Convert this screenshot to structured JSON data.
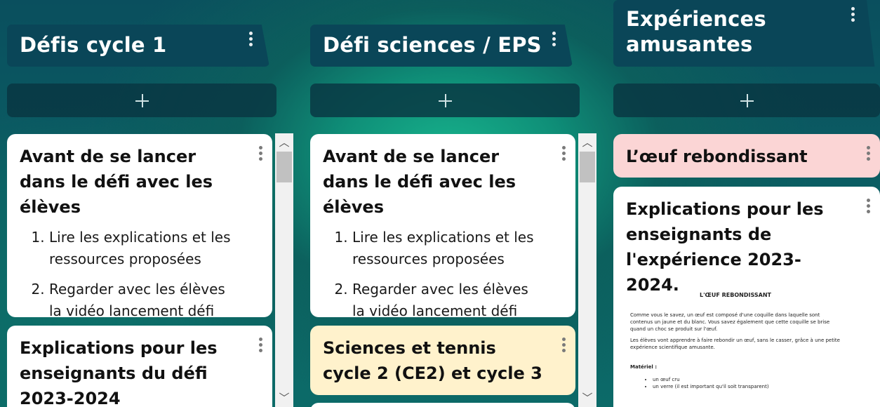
{
  "columns": [
    {
      "title": "Défis cycle 1",
      "cards": [
        {
          "title": "Avant de se lancer dans le défi avec les élèves",
          "items": [
            "Lire les explications et les ressources proposées",
            "Regarder avec les élèves la vidéo lancement défi"
          ]
        },
        {
          "title": "Explications pour les enseignants du défi 2023-2024"
        }
      ]
    },
    {
      "title": "Défi sciences / EPS",
      "cards": [
        {
          "title": "Avant de se lancer dans le défi avec les élèves",
          "items": [
            "Lire les explications et les ressources proposées",
            "Regarder avec les élèves la vidéo lancement défi"
          ]
        },
        {
          "title": "Sciences et tennis cycle 2 (CE2) et cycle 3"
        }
      ]
    },
    {
      "title": "Expériences amusantes",
      "cards": [
        {
          "title": "L’œuf rebondissant"
        },
        {
          "title": "Explications pour les enseignants de l'expérience 2023-2024.",
          "document": {
            "heading": "L'ŒUF REBONDISSANT",
            "paragraphs": [
              "Comme vous le savez, un œuf est composé d'une coquille dans laquelle sont contenus un jaune et du blanc. Vous savez également que cette coquille se brise quand un choc se produit sur l'œuf.",
              "Les élèves vont apprendre à faire rebondir un œuf, sans le casser, grâce à une petite expérience scientifique amusante."
            ],
            "materiel_label": "Matériel :",
            "materiel": [
              "un œuf cru",
              "un verre (il est important qu'il soit transparent)"
            ]
          }
        }
      ]
    }
  ],
  "add_button_icon": "plus-icon",
  "menu_icon": "more-vertical-icon",
  "colors": {
    "header_bg": "#0a4658",
    "card_white": "#ffffff",
    "card_pink": "#fbd5d5",
    "card_yellow": "#fff2cc"
  }
}
